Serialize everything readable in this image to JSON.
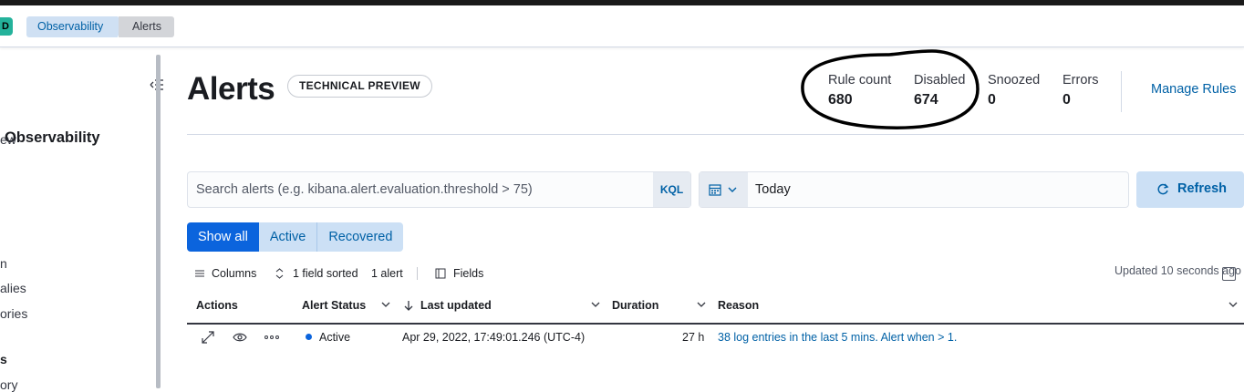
{
  "breadcrumbs": [
    "Observability",
    "Alerts"
  ],
  "logo_text": "D",
  "sidebar": {
    "title": "Observability",
    "items": [
      "ew",
      "n",
      "alies",
      "ories"
    ],
    "group": "s",
    "group_items": [
      "ory"
    ]
  },
  "page": {
    "title": "Alerts",
    "badge": "TECHNICAL PREVIEW"
  },
  "stats": [
    {
      "label": "Rule count",
      "value": "680"
    },
    {
      "label": "Disabled",
      "value": "674"
    },
    {
      "label": "Snoozed",
      "value": "0"
    },
    {
      "label": "Errors",
      "value": "0"
    }
  ],
  "manage_rules": "Manage Rules",
  "search": {
    "placeholder": "Search alerts (e.g. kibana.alert.evaluation.threshold > 75)",
    "language": "KQL"
  },
  "date_picker": {
    "value": "Today"
  },
  "refresh_label": "Refresh",
  "filters": [
    {
      "label": "Show all",
      "selected": true
    },
    {
      "label": "Active",
      "selected": false
    },
    {
      "label": "Recovered",
      "selected": false
    }
  ],
  "toolbar": {
    "columns": "Columns",
    "sorted": "1 field sorted",
    "count": "1 alert",
    "fields": "Fields",
    "updated": "Updated 10 seconds ago"
  },
  "table": {
    "headers": [
      "Actions",
      "Alert Status",
      "Last updated",
      "Duration",
      "Reason"
    ],
    "rows": [
      {
        "status": "Active",
        "last_updated": "Apr 29, 2022, 17:49:01.246 (UTC-4)",
        "duration": "27 h",
        "reason": "38 log entries in the last 5 mins. Alert when > 1."
      }
    ]
  },
  "colors": {
    "accent": "#0b64dd",
    "link": "#0061a6",
    "teal": "#24b29b"
  }
}
